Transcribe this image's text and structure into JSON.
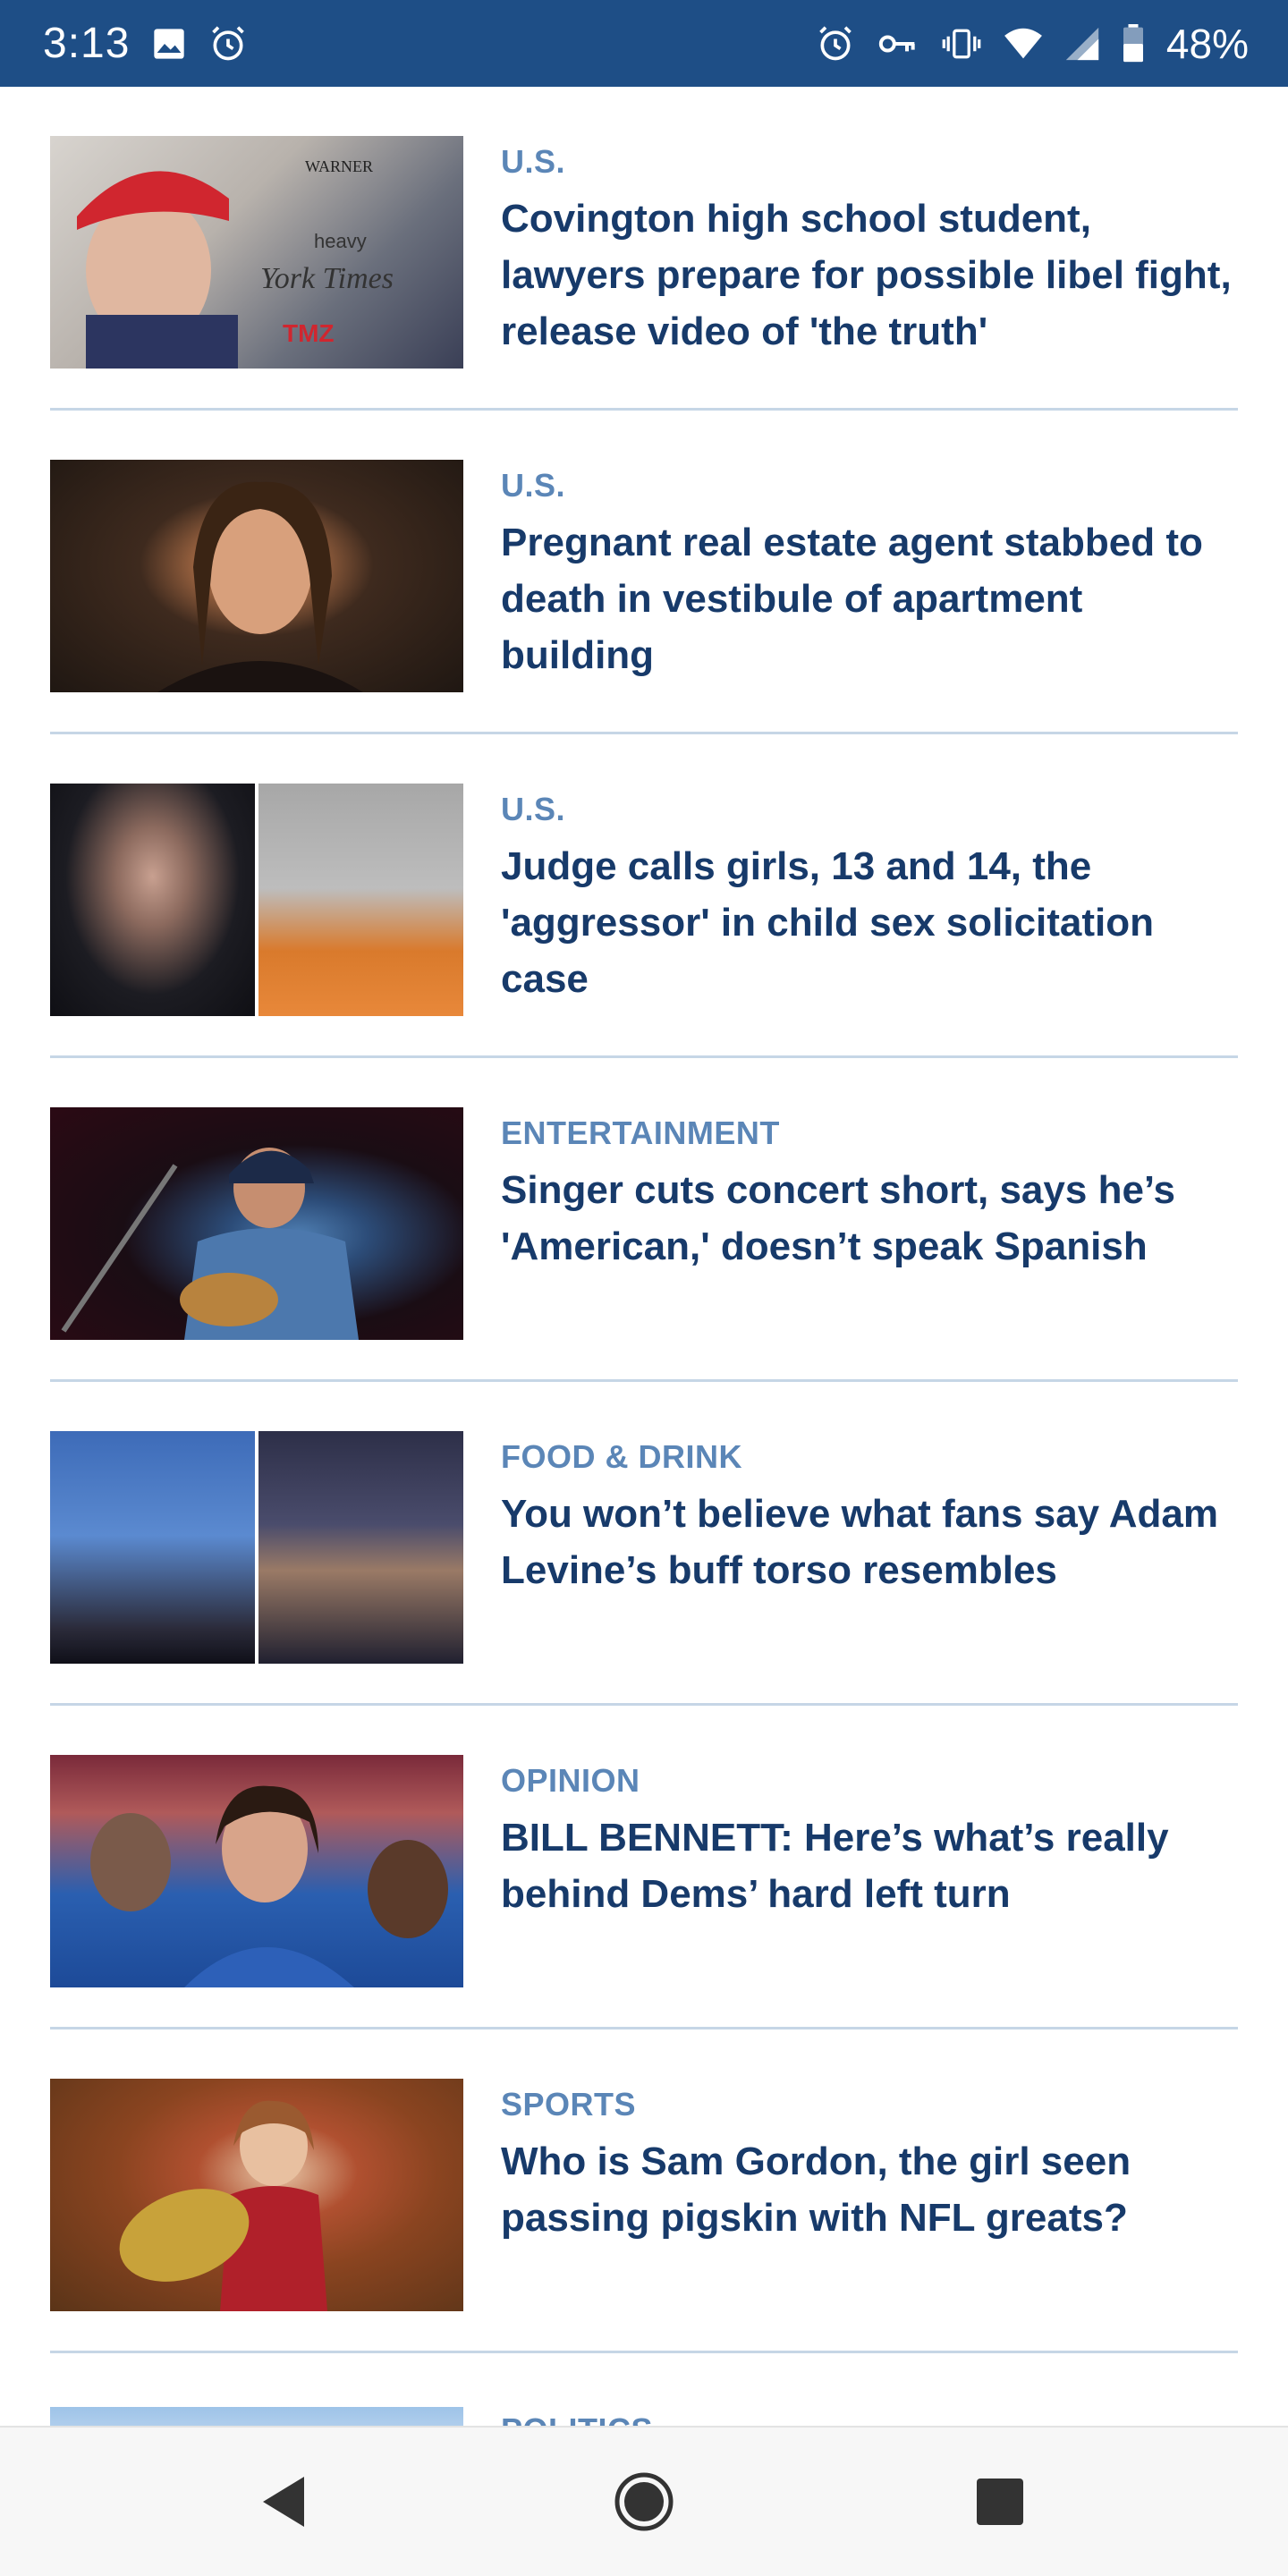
{
  "status_bar": {
    "time": "3:13",
    "battery_percent": "48%",
    "background_color": "#1e4e86",
    "left_icons": [
      "image-icon",
      "alarm-icon"
    ],
    "right_icons": [
      "alarm-icon",
      "vpn-key-icon",
      "vibrate-icon",
      "wifi-icon",
      "cell-signal-icon",
      "battery-icon"
    ]
  },
  "feed": {
    "accent_category_color": "#5b86b7",
    "headline_color": "#173a6a",
    "articles": [
      {
        "category": "U.S.",
        "headline": "Covington high school student, lawyers prepare for possible libel fight, release video of 'the truth'"
      },
      {
        "category": "U.S.",
        "headline": "Pregnant real estate agent stabbed to death in vestibule of apartment building"
      },
      {
        "category": "U.S.",
        "headline": "Judge calls girls, 13 and 14, the 'aggressor' in child sex solicitation case"
      },
      {
        "category": "ENTERTAINMENT",
        "headline": "Singer cuts concert short, says he’s 'American,' doesn’t speak Spanish"
      },
      {
        "category": "FOOD & DRINK",
        "headline": "You won’t believe what fans say Adam Levine’s buff torso resembles"
      },
      {
        "category": "OPINION",
        "headline": "BILL BENNETT: Here’s what’s really behind Dems’ hard left turn"
      },
      {
        "category": "SPORTS",
        "headline": "Who is Sam Gordon, the girl seen passing pigskin with NFL greats?"
      }
    ],
    "partial_article": {
      "category": "POLITICS"
    }
  },
  "nav_bar": {
    "buttons": [
      "back-icon",
      "home-icon",
      "recents-icon"
    ]
  }
}
